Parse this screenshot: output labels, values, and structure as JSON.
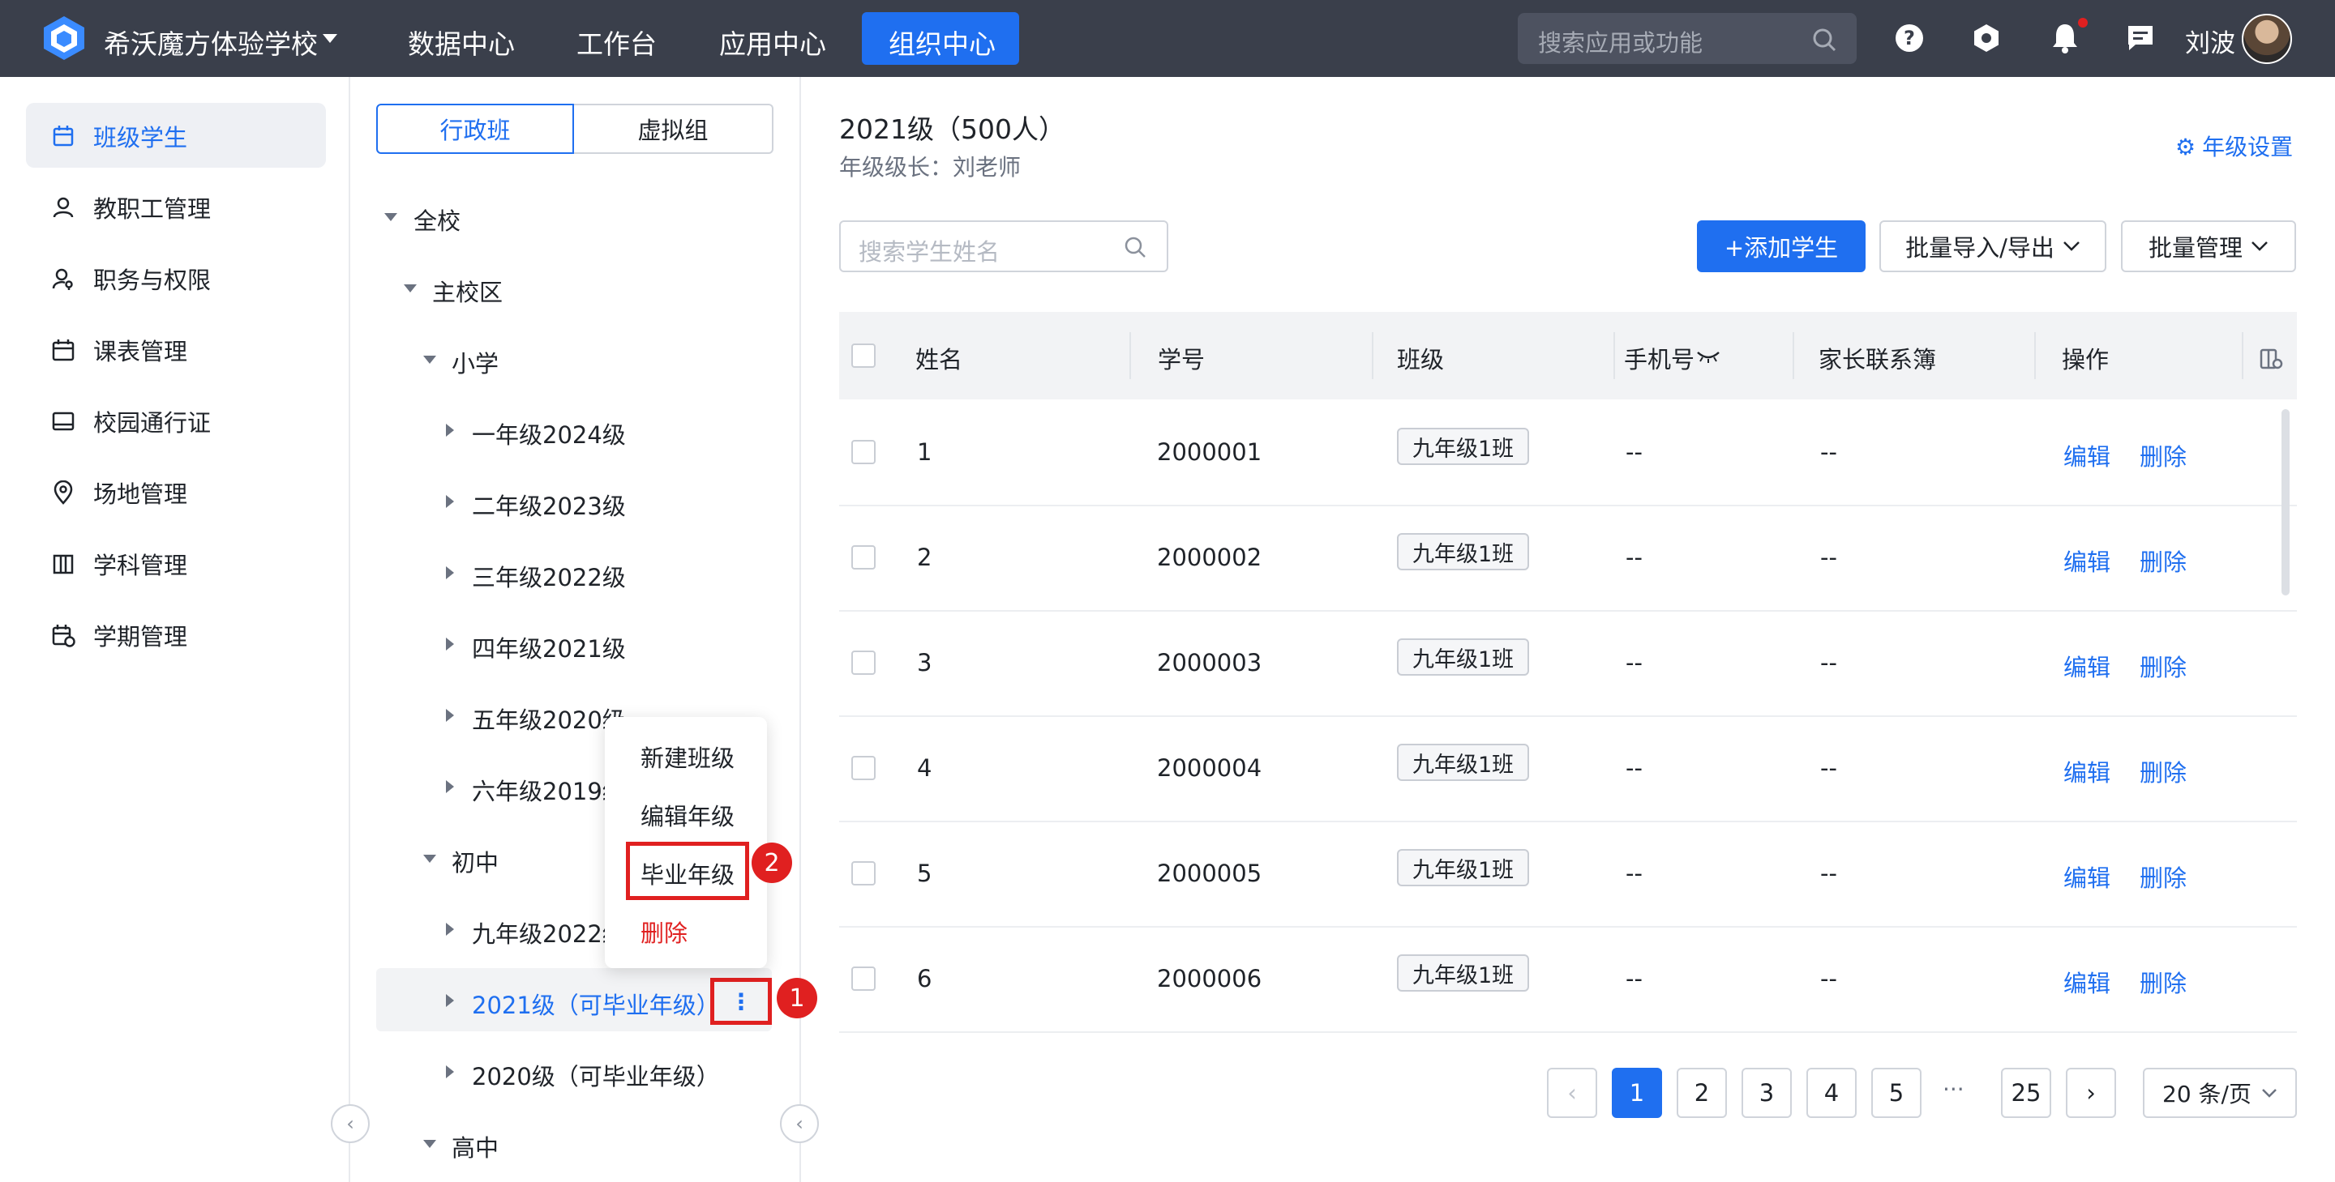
{
  "header": {
    "school_name": "希沃魔方体验学校",
    "nav": [
      "数据中心",
      "工作台",
      "应用中心",
      "组织中心"
    ],
    "active_nav": "组织中心",
    "search_placeholder": "搜索应用或功能",
    "user_name": "刘波",
    "notification_dot_color": "#e02020"
  },
  "sidebar": {
    "items": [
      {
        "label": "班级学生",
        "icon": "building-icon"
      },
      {
        "label": "教职工管理",
        "icon": "user-icon"
      },
      {
        "label": "职务与权限",
        "icon": "user-key-icon"
      },
      {
        "label": "课表管理",
        "icon": "calendar-icon"
      },
      {
        "label": "校园通行证",
        "icon": "card-icon"
      },
      {
        "label": "场地管理",
        "icon": "location-icon"
      },
      {
        "label": "学科管理",
        "icon": "book-icon"
      },
      {
        "label": "学期管理",
        "icon": "calendar-clock-icon"
      }
    ],
    "active": "班级学生"
  },
  "tree": {
    "tabs": [
      "行政班",
      "虚拟组"
    ],
    "active_tab": "行政班",
    "nodes": {
      "root": "全校",
      "campus": "主校区",
      "primary": "小学",
      "g1": "一年级2024级",
      "g2": "二年级2023级",
      "g3": "三年级2022级",
      "g4": "四年级2021级",
      "g5": "五年级2020级",
      "g6": "六年级2019级",
      "junior": "初中",
      "g9": "九年级2022级",
      "y2021": "2021级（可毕业年级）",
      "y2020": "2020级（可毕业年级）",
      "senior": "高中"
    },
    "more_icon": "⋮",
    "context_menu": [
      "新建班级",
      "编辑年级",
      "毕业年级",
      "删除"
    ],
    "annotations": [
      "1",
      "2"
    ]
  },
  "main": {
    "title": "2021级（500人）",
    "subtitle": "年级级长：刘老师",
    "settings_label": "年级设置",
    "search_placeholder": "搜索学生姓名",
    "add_button": "+添加学生",
    "import_export": "批量导入/导出",
    "batch_manage": "批量管理",
    "columns": [
      "姓名",
      "学号",
      "班级",
      "手机号",
      "家长联系簿",
      "操作"
    ],
    "rows": [
      {
        "name": "1",
        "id": "2000001",
        "class": "九年级1班",
        "phone": "--",
        "parent": "--"
      },
      {
        "name": "2",
        "id": "2000002",
        "class": "九年级1班",
        "phone": "--",
        "parent": "--"
      },
      {
        "name": "3",
        "id": "2000003",
        "class": "九年级1班",
        "phone": "--",
        "parent": "--"
      },
      {
        "name": "4",
        "id": "2000004",
        "class": "九年级1班",
        "phone": "--",
        "parent": "--"
      },
      {
        "name": "5",
        "id": "2000005",
        "class": "九年级1班",
        "phone": "--",
        "parent": "--"
      },
      {
        "name": "6",
        "id": "2000006",
        "class": "九年级1班",
        "phone": "--",
        "parent": "--"
      }
    ],
    "edit_label": "编辑",
    "delete_label": "删除",
    "pagination": {
      "pages": [
        "1",
        "2",
        "3",
        "4",
        "5"
      ],
      "ellipsis": "···",
      "last": "25",
      "current": "1",
      "page_size": "20 条/页"
    }
  }
}
